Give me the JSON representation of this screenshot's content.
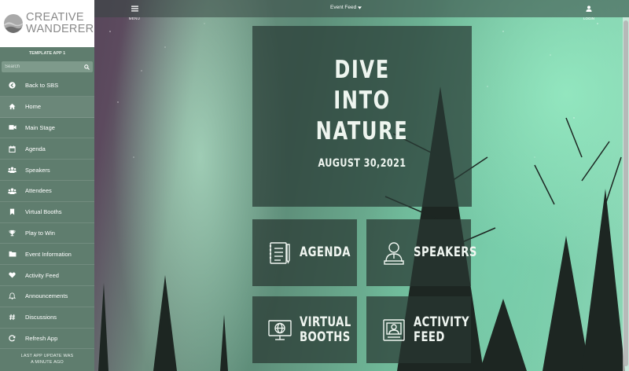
{
  "brand": {
    "line1": "CREATIVE",
    "line2": "WANDERER"
  },
  "sidebar": {
    "app_name": "TEMPLATE APP 1",
    "search_placeholder": "Search",
    "items": [
      {
        "label": "Back to SBS",
        "icon": "arrow-left-circle-icon"
      },
      {
        "label": "Home",
        "icon": "home-icon"
      },
      {
        "label": "Main Stage",
        "icon": "video-camera-icon"
      },
      {
        "label": "Agenda",
        "icon": "calendar-icon"
      },
      {
        "label": "Speakers",
        "icon": "users-icon"
      },
      {
        "label": "Attendees",
        "icon": "users-icon"
      },
      {
        "label": "Virtual Booths",
        "icon": "bookmark-icon"
      },
      {
        "label": "Play to Win",
        "icon": "trophy-icon"
      },
      {
        "label": "Event Information",
        "icon": "folder-icon"
      },
      {
        "label": "Activity Feed",
        "icon": "heart-icon"
      },
      {
        "label": "Announcements",
        "icon": "bell-icon"
      },
      {
        "label": "Discussions",
        "icon": "hashtag-icon"
      },
      {
        "label": "Refresh App",
        "icon": "refresh-icon"
      }
    ],
    "update_note_line1": "LAST APP UPDATE WAS",
    "update_note_line2": "A MINUTE AGO"
  },
  "topbar": {
    "menu_label": "MENU",
    "title": "Event Feed",
    "login_label": "LOGIN"
  },
  "hero": {
    "title_lines": [
      "DIVE",
      "INTO",
      "NATURE"
    ],
    "date": "AUGUST 30,2021"
  },
  "tiles": [
    {
      "line1": "AGENDA",
      "line2": "",
      "icon": "notepad-icon"
    },
    {
      "line1": "SPEAKERS",
      "line2": "",
      "icon": "speaker-person-icon"
    },
    {
      "line1": "VIRTUAL",
      "line2": "BOOTHS",
      "icon": "monitor-globe-icon"
    },
    {
      "line1": "ACTIVITY",
      "line2": "FEED",
      "icon": "profile-card-icon"
    }
  ],
  "colors": {
    "sidebar": "#5f7d6e",
    "tile_bg": "#283832",
    "accent_text": "#eef5ef"
  }
}
